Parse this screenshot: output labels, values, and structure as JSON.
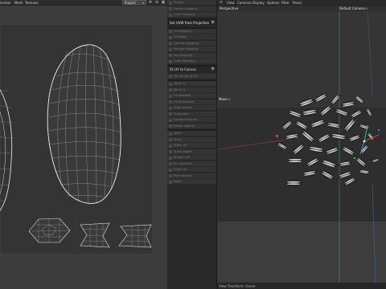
{
  "uv_editor": {
    "menu": [
      "lection",
      "Mesh",
      "Textures"
    ],
    "dropdown_value": "Project"
  },
  "tool_panel": {
    "rows": [
      {
        "kind": "btn",
        "label": "Project"
      },
      {
        "kind": "btn",
        "label": "Frontal Mapping"
      },
      {
        "kind": "btn",
        "label": "Cubic Mapping"
      },
      {
        "kind": "sep"
      },
      {
        "kind": "header",
        "label": "Set UVW from Projection"
      },
      {
        "kind": "sep"
      },
      {
        "kind": "btn",
        "label": "UV Mapping"
      },
      {
        "kind": "btn",
        "label": "UV Relax"
      },
      {
        "kind": "btn",
        "label": "Optimal Mapping"
      },
      {
        "kind": "btn",
        "label": "Realign Mapping"
      },
      {
        "kind": "btn",
        "label": "Box Mapping"
      },
      {
        "kind": "btn",
        "label": "Cubic Mapping"
      },
      {
        "kind": "sep"
      },
      {
        "kind": "header",
        "label": "Fit UV to Canvas"
      },
      {
        "kind": "btn",
        "label": "Fit Canvas to UV"
      },
      {
        "kind": "sep"
      },
      {
        "kind": "btn",
        "label": "Mirror U"
      },
      {
        "kind": "btn",
        "label": "Mirror V"
      },
      {
        "kind": "btn",
        "label": "Fit Selected"
      },
      {
        "kind": "btn",
        "label": "Fit Unselected"
      },
      {
        "kind": "btn",
        "label": "Align Islands"
      },
      {
        "kind": "btn",
        "label": "Straighten"
      },
      {
        "kind": "btn",
        "label": "Equalize Islands"
      },
      {
        "kind": "btn",
        "label": "Rotate Islands"
      },
      {
        "kind": "sep"
      },
      {
        "kind": "btn",
        "label": "Weld"
      },
      {
        "kind": "btn",
        "label": "Stitch"
      },
      {
        "kind": "btn",
        "label": "Stitch All"
      },
      {
        "kind": "btn",
        "label": "Stitch Edges"
      },
      {
        "kind": "btn",
        "label": "Smooth UV"
      },
      {
        "kind": "btn",
        "label": "Pin Selected"
      },
      {
        "kind": "btn",
        "label": "Unpin All"
      },
      {
        "kind": "btn",
        "label": "Pack Islands"
      },
      {
        "kind": "btn",
        "label": "Reset"
      }
    ]
  },
  "viewport": {
    "menu": [
      "View",
      "Cameras",
      "Display",
      "Options",
      "Filter",
      "Panel"
    ],
    "view_name": "Perspective",
    "camera_name": "Default Camera",
    "object_label": "Move",
    "status_text": "View Transform: Scene"
  },
  "colors": {
    "selection_blue": "#2f8fd8",
    "axis_x": "#d04040",
    "axis_y": "#40c060",
    "axis_z": "#4a8ad8",
    "highlight": "#ffffff"
  }
}
